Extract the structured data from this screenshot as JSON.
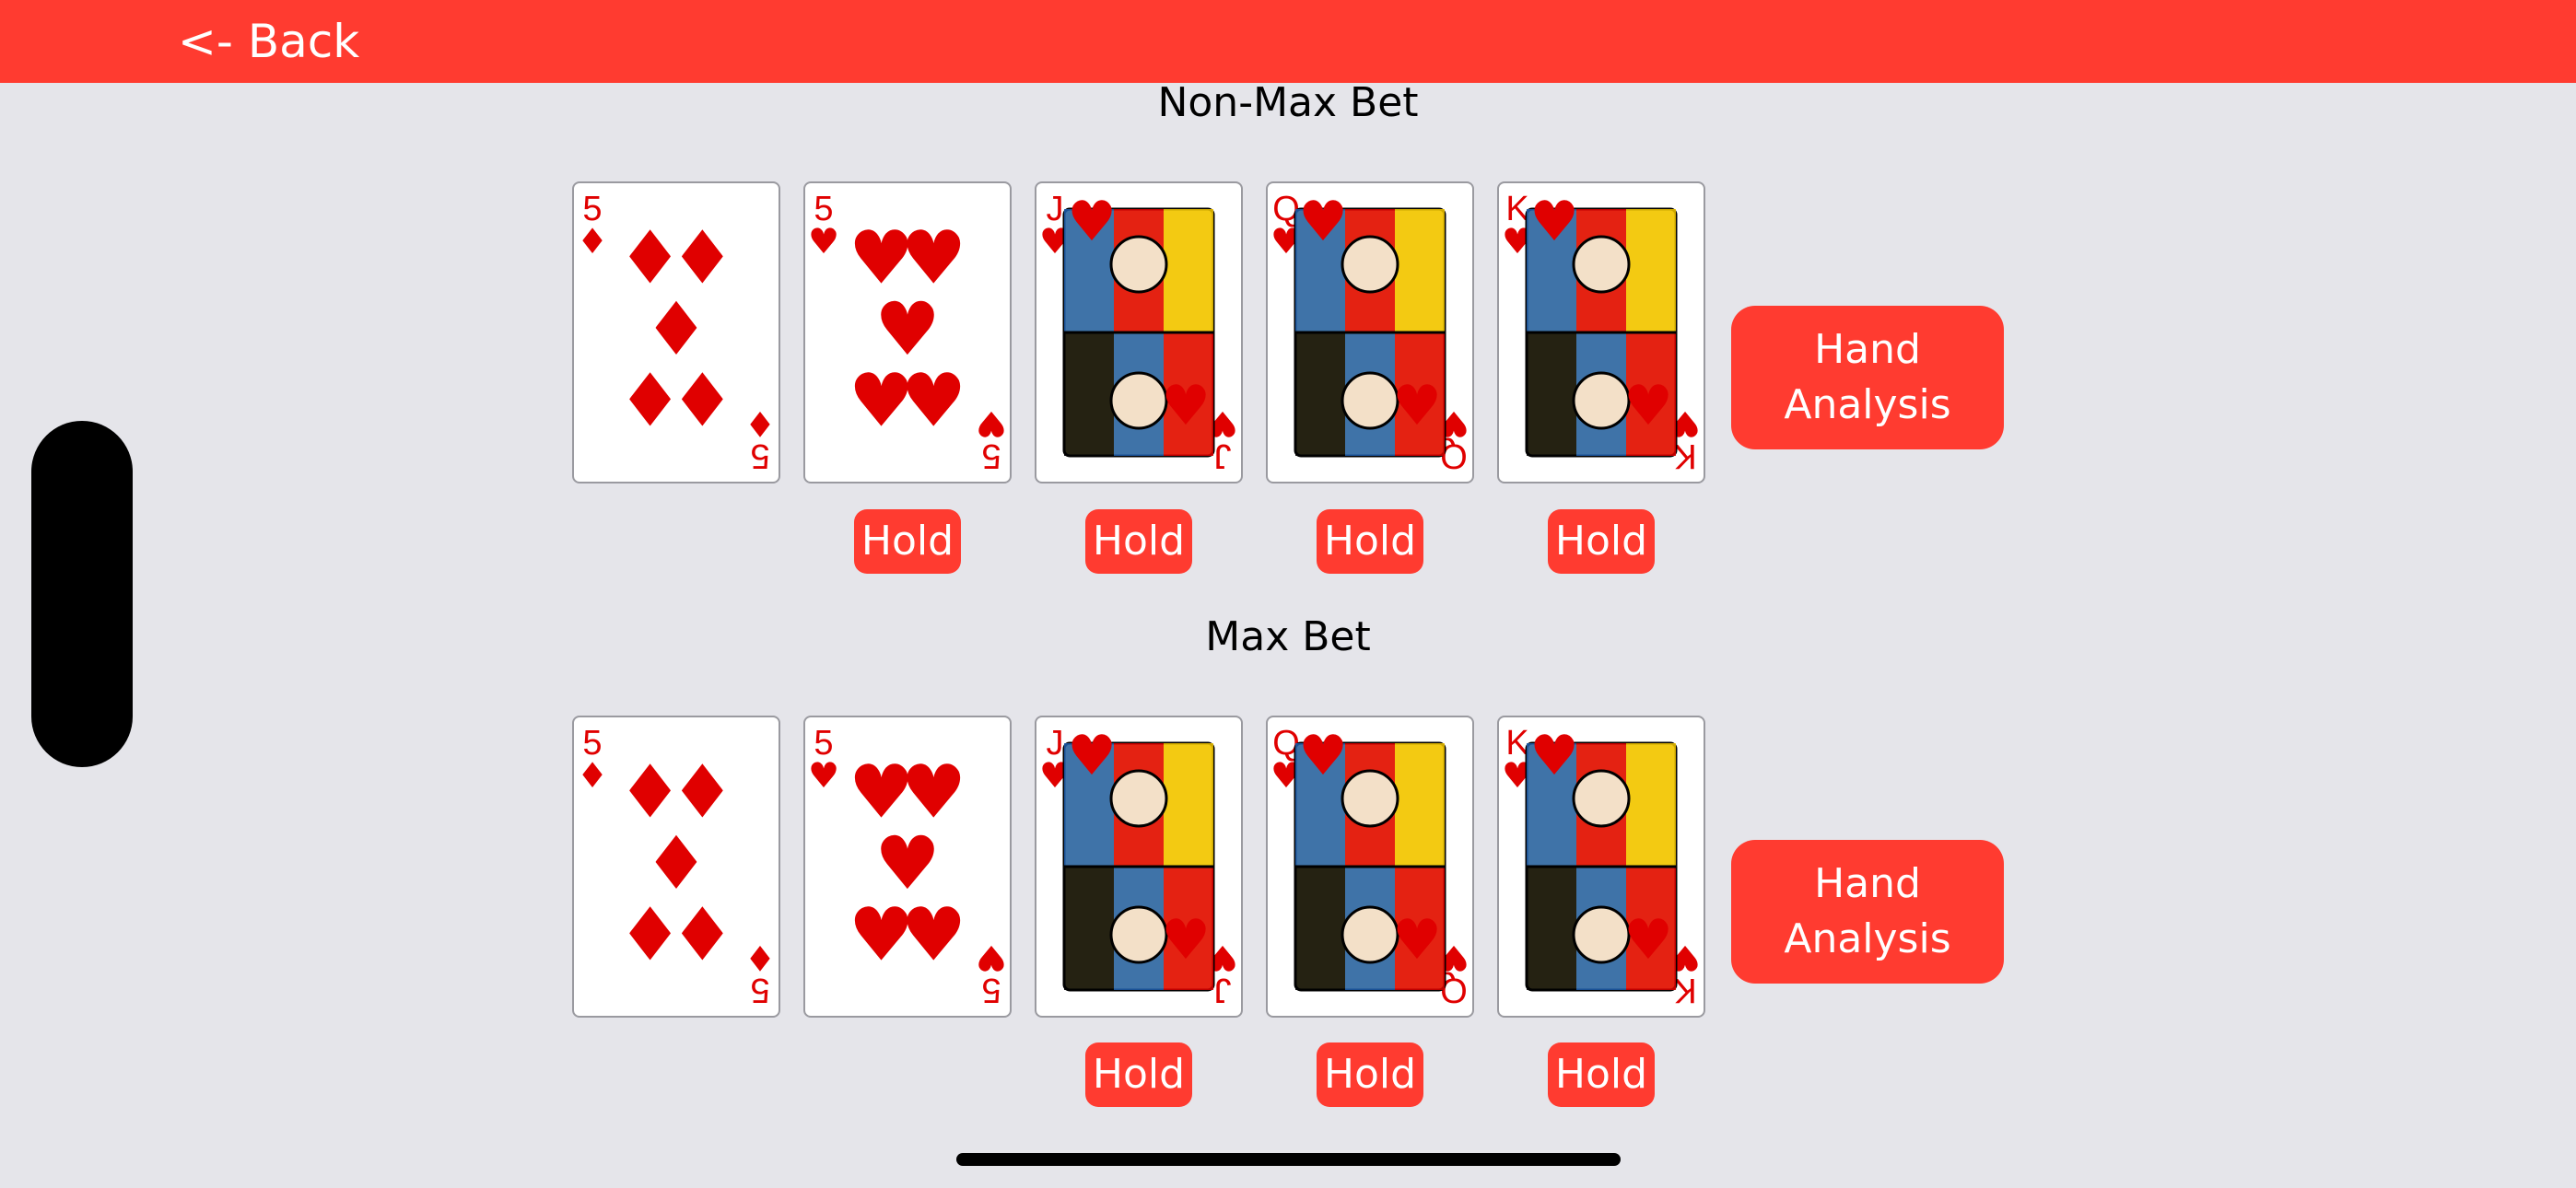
{
  "nav": {
    "back_label": "<- Back"
  },
  "colors": {
    "accent": "#ff3b30",
    "background": "#e5e5ea",
    "card_red": "#e00000"
  },
  "sections": [
    {
      "title": "Non-Max Bet",
      "cards": [
        {
          "rank": "5",
          "suit": "diamonds",
          "suit_symbol": "♦",
          "held": false
        },
        {
          "rank": "5",
          "suit": "hearts",
          "suit_symbol": "♥",
          "held": true
        },
        {
          "rank": "J",
          "suit": "hearts",
          "suit_symbol": "♥",
          "held": true
        },
        {
          "rank": "Q",
          "suit": "hearts",
          "suit_symbol": "♥",
          "held": true
        },
        {
          "rank": "K",
          "suit": "hearts",
          "suit_symbol": "♥",
          "held": true
        }
      ],
      "hold_label": "Hold",
      "analysis_line1": "Hand",
      "analysis_line2": "Analysis"
    },
    {
      "title": "Max Bet",
      "cards": [
        {
          "rank": "5",
          "suit": "diamonds",
          "suit_symbol": "♦",
          "held": false
        },
        {
          "rank": "5",
          "suit": "hearts",
          "suit_symbol": "♥",
          "held": false
        },
        {
          "rank": "J",
          "suit": "hearts",
          "suit_symbol": "♥",
          "held": true
        },
        {
          "rank": "Q",
          "suit": "hearts",
          "suit_symbol": "♥",
          "held": true
        },
        {
          "rank": "K",
          "suit": "hearts",
          "suit_symbol": "♥",
          "held": true
        }
      ],
      "hold_label": "Hold",
      "analysis_line1": "Hand",
      "analysis_line2": "Analysis"
    }
  ]
}
